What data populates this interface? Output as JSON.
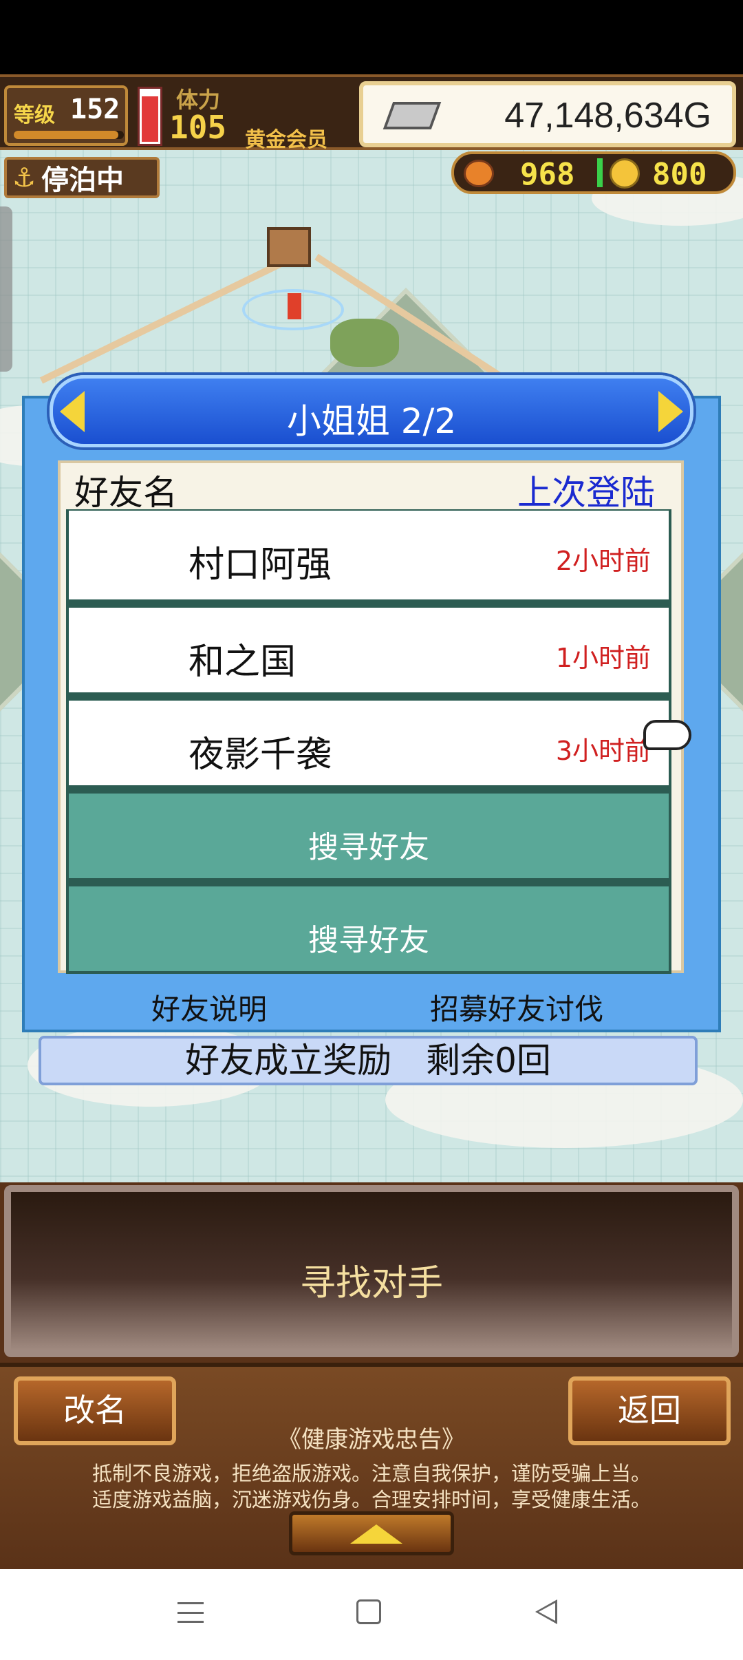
{
  "hud": {
    "level_label": "等级",
    "level_value": "152",
    "level_progress": 0.95,
    "stamina_label": "体力",
    "stamina_value": "105",
    "stamina_gauge_level": 0.9,
    "membership": "黄金会员",
    "gold": "47,148,634G",
    "anchor_status": "停泊中",
    "resource_a": "968",
    "resource_b": "800"
  },
  "dialog": {
    "title": "小姐姐 2/2",
    "header_name": "好友名",
    "header_login": "上次登陆",
    "friends": [
      {
        "name": "村口阿强",
        "last_login": "2小时前"
      },
      {
        "name": "和之国",
        "last_login": "1小时前"
      },
      {
        "name": "夜影千袭",
        "last_login": "3小时前"
      }
    ],
    "search_slots": [
      "搜寻好友",
      "搜寻好友"
    ],
    "footer_left": "好友说明",
    "footer_right": "招募好友讨伐",
    "reward": "好友成立奖励　剩余0回"
  },
  "bottom": {
    "find_opponent": "寻找对手",
    "rename": "改名",
    "back": "返回",
    "notice_title": "《健康游戏忠告》",
    "notice_line1": "抵制不良游戏，拒绝盗版游戏。注意自我保护，谨防受骗上当。",
    "notice_line2": "适度游戏益脑，沉迷游戏伤身。合理安排时间，享受健康生活。"
  },
  "colors": {
    "dialog_blue": "#5ea8ee",
    "search_green": "#5aa898",
    "time_red": "#d02020",
    "login_blue": "#1a2ad0"
  },
  "icons": [
    "anchor-icon",
    "silver-bar-icon",
    "orange-gem-icon",
    "gold-coin-icon",
    "hand-pointer-icon",
    "arrow-left-icon",
    "arrow-right-icon",
    "up-arrow-icon"
  ]
}
